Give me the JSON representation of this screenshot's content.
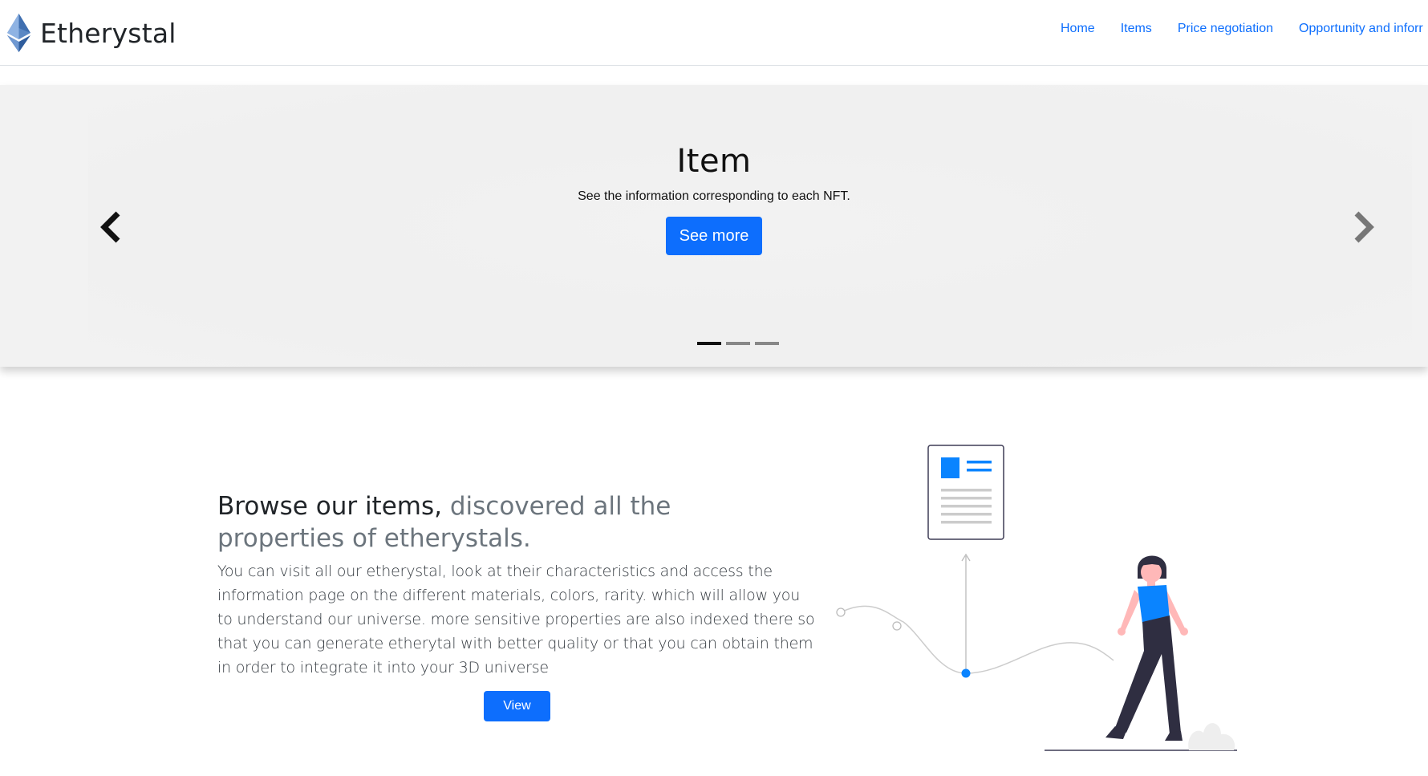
{
  "app": {
    "brand_name": "Etherystal",
    "brand_logo_icon": "ethereum-diamond-icon"
  },
  "nav": {
    "items": [
      {
        "label": "Home"
      },
      {
        "label": "Items"
      },
      {
        "label": "Price negotiation"
      },
      {
        "label": "Opportunity and inforr"
      }
    ]
  },
  "carousel": {
    "title": "Item",
    "subtitle": "See the information corresponding to each NFT.",
    "button_label": "See more",
    "prev_icon": "chevron-left-icon",
    "next_icon": "chevron-right-icon",
    "indicator_count": 3,
    "active_index": 0
  },
  "section": {
    "headline_dark": "Browse our items,",
    "headline_muted": "discovered all the properties of etherystals.",
    "body": "You can visit all our etherystal, look at their characteristics and access the information page on the different materials, colors, rarity. which will allow you to understand our universe. more sensitive properties are also indexed there so that you can generate etherytal with better quality or that you can obtain them in order to integrate it into your 3D universe",
    "button_label": "View",
    "illustration": "woman-with-document-illustration"
  },
  "colors": {
    "primary": "#0d6efd",
    "accent": "#0a84ff",
    "muted": "#6c757d",
    "carousel_bg": "#f2f2f2"
  }
}
